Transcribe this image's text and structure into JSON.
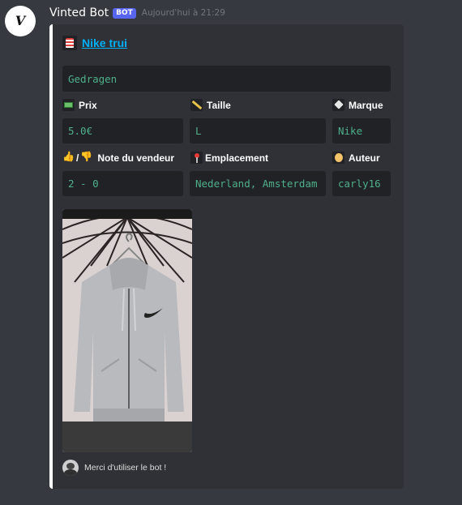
{
  "message": {
    "author_initial": "V",
    "username": "Vinted Bot",
    "bot_tag": "BOT",
    "timestamp": "Aujourd'hui à 21:29"
  },
  "embed": {
    "accent_color": "#ffffff",
    "title": "Nike trui",
    "title_icon": "striped-shirt-icon",
    "description": "Gedragen",
    "fields": {
      "prix": {
        "name": "Prix",
        "icon": "money-icon",
        "value": "5.0€"
      },
      "taille": {
        "name": "Taille",
        "icon": "ruler-icon",
        "value": "L"
      },
      "marque": {
        "name": "Marque",
        "icon": "tag-icon",
        "value": "Nike"
      },
      "note": {
        "name": "Note du vendeur",
        "separator": "/",
        "icon_up": "thumbs-up-icon",
        "icon_down": "thumbs-down-icon",
        "value": "2 - 0"
      },
      "emplacement": {
        "name": "Emplacement",
        "icon": "pin-icon",
        "value": "Nederland, Amsterdam"
      },
      "auteur": {
        "name": "Auteur",
        "icon": "person-icon",
        "value": "carly16"
      }
    },
    "image": {
      "subject": "grey-nike-hoodie-photo"
    },
    "footer": {
      "text": "Merci d'utiliser le bot !",
      "icon": "footer-avatar-icon"
    }
  }
}
